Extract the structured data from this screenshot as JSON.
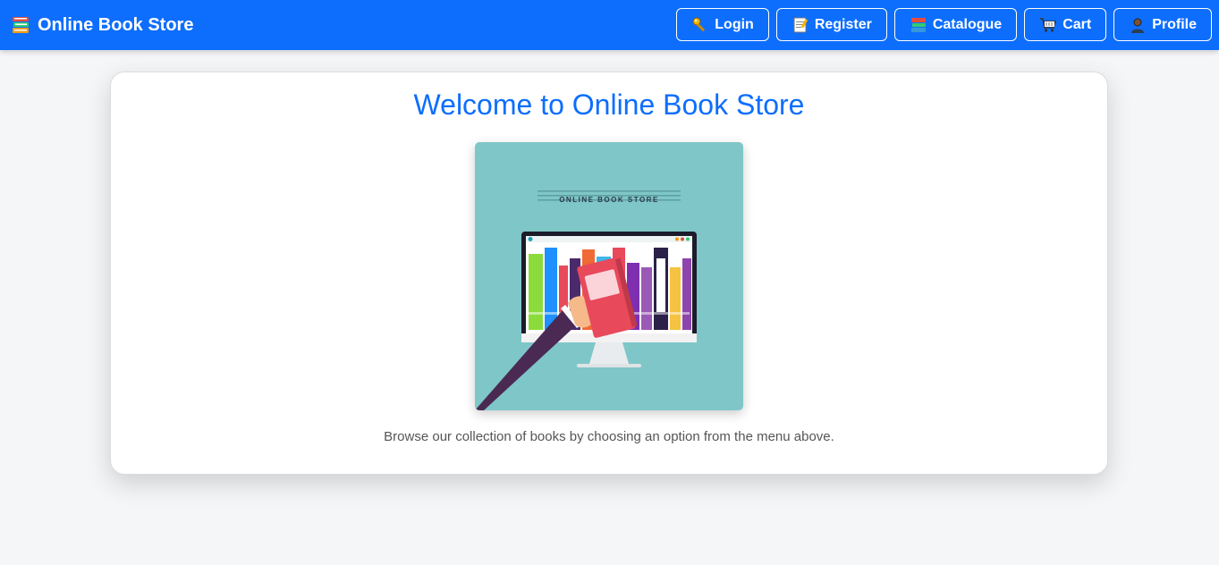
{
  "navbar": {
    "brand": "Online Book Store",
    "brand_icon": "books-icon",
    "buttons": [
      {
        "label": "Login",
        "icon": "key-icon"
      },
      {
        "label": "Register",
        "icon": "memo-icon"
      },
      {
        "label": "Catalogue",
        "icon": "books-icon"
      },
      {
        "label": "Cart",
        "icon": "cart-icon"
      },
      {
        "label": "Profile",
        "icon": "user-icon"
      }
    ]
  },
  "main": {
    "title": "Welcome to Online Book Store",
    "hero_caption": "ONLINE BOOK STORE",
    "description": "Browse our collection of books by choosing an option from the menu above."
  },
  "colors": {
    "primary": "#0d6efd",
    "background": "#f5f6f8",
    "hero_bg": "#7fc6c8"
  }
}
